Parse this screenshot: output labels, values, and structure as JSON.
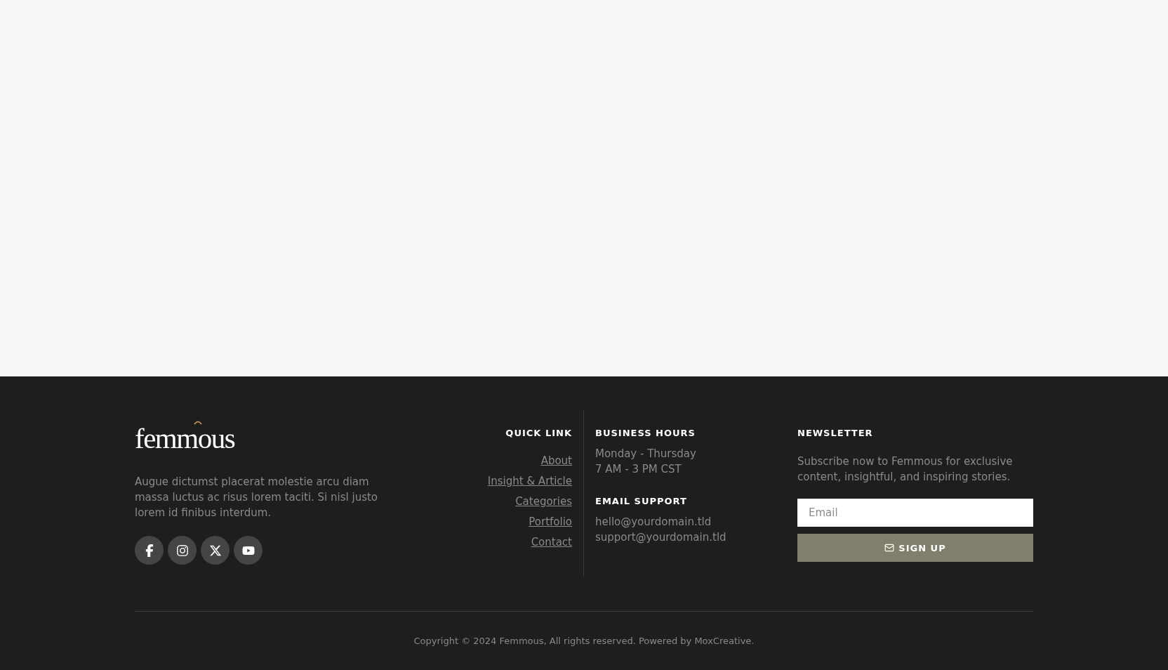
{
  "brand": {
    "logo": "femmous",
    "description": "Augue dictumst placerat molestie arcu diam massa luctus ac risus lorem taciti. Si nisl justo lorem id finibus interdum.",
    "socials": [
      {
        "kind": "facebook"
      },
      {
        "kind": "instagram"
      },
      {
        "kind": "x"
      },
      {
        "kind": "youtube"
      }
    ]
  },
  "quick_link": {
    "heading": "QUICK LINK",
    "links": [
      "About",
      "Insight & Article",
      "Categories",
      "Portfolio",
      "Contact"
    ]
  },
  "business_hours": {
    "heading": "BUSINESS HOURS",
    "lines": [
      "Monday - Thursday",
      "7 AM - 3 PM CST"
    ]
  },
  "email_support": {
    "heading": "EMAIL SUPPORT",
    "lines": [
      "hello@yourdomain.tld",
      "support@yourdomain.tld"
    ]
  },
  "newsletter": {
    "heading": "NEWSLETTER",
    "text": "Subscribe now to Femmous for exclusive content, insightful, and inspiring stories.",
    "email": {
      "placeholder": "Email"
    },
    "button": "SIGN UP"
  },
  "copyright": "Copyright © 2024 Femmous, All rights reserved. Powered by MoxCreative."
}
